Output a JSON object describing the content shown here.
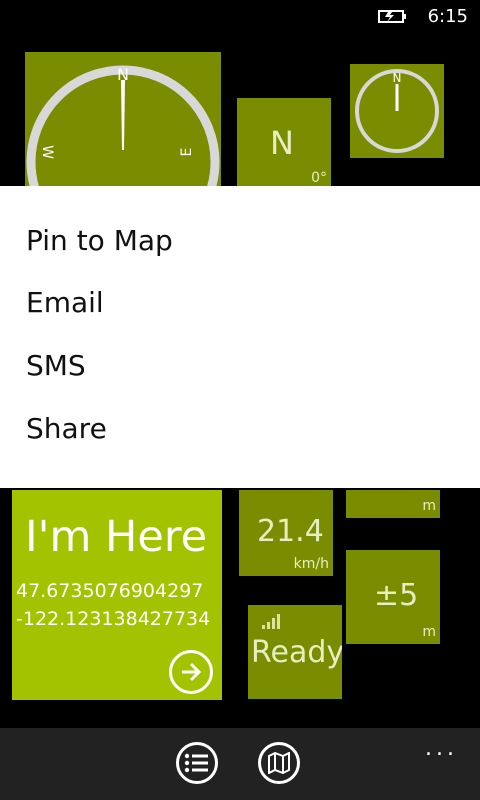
{
  "status_bar": {
    "time": "6:15",
    "battery_icon": "battery-charging-icon"
  },
  "tiles": {
    "heading_letter": "N",
    "heading_degrees": "0°",
    "compass_labels": {
      "north": "N",
      "west": "W",
      "east": "E"
    },
    "clock_label": "N",
    "speed_value": "21.4",
    "speed_unit": "km/h",
    "top_right_unit": "m",
    "accuracy_value": "±5",
    "accuracy_unit": "m",
    "gps_status": "Ready"
  },
  "context_menu": {
    "items": [
      "Pin to Map",
      "Email",
      "SMS",
      "Share"
    ]
  },
  "here_tile": {
    "title": "I'm Here",
    "latitude": "47.6735076904297",
    "longitude": "-122.123138427734",
    "go_icon": "arrow-right-circle-icon"
  },
  "app_bar": {
    "list_icon": "list-icon",
    "map_icon": "map-icon",
    "more": "..."
  },
  "colors": {
    "tile": "#7a8c00",
    "accent": "#a3c300",
    "menu_bg": "#ffffff",
    "appbar_bg": "#222222"
  }
}
